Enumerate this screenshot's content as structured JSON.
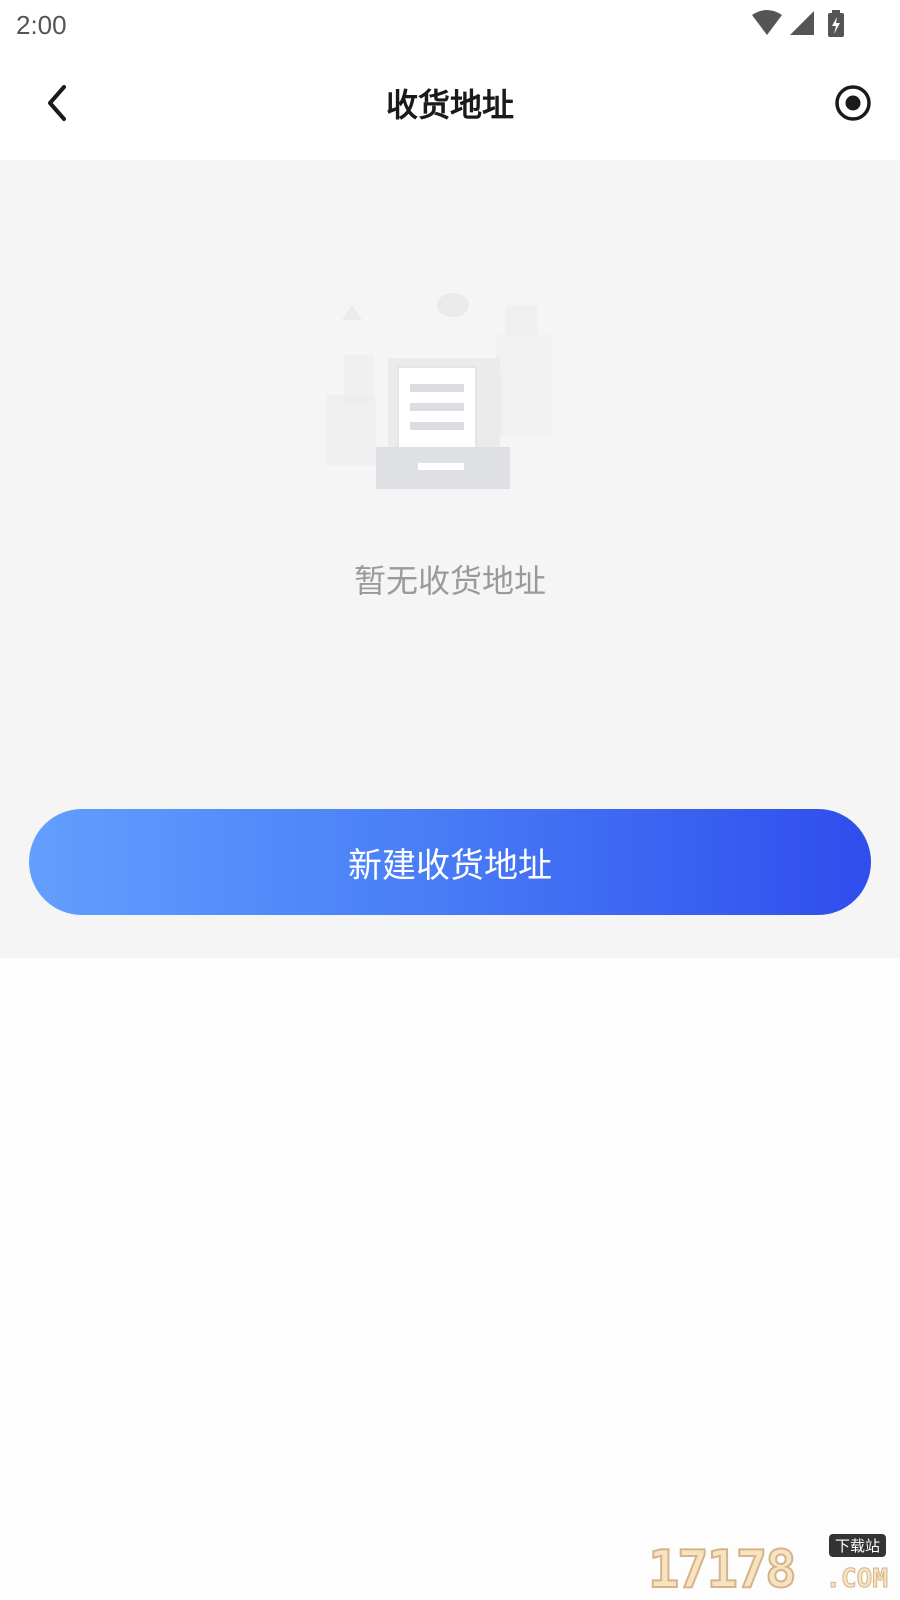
{
  "status_bar": {
    "time": "2:00",
    "icons": [
      "wifi-icon",
      "cell-signal-icon",
      "battery-charging-icon"
    ]
  },
  "nav": {
    "title": "收货地址",
    "back_icon": "chevron-left-icon",
    "action_icon": "record-icon"
  },
  "empty_state": {
    "illustration": "empty-document-icon",
    "message": "暂无收货地址"
  },
  "actions": {
    "new_address_label": "新建收货地址"
  },
  "watermark": {
    "digits": "17178",
    "badge": "下载站",
    "suffix": ".COM"
  },
  "colors": {
    "button_gradient_start": "#629ffe",
    "button_gradient_end": "#2f4ded",
    "content_background": "#f5f5f5",
    "empty_text": "#9a9a9a"
  }
}
